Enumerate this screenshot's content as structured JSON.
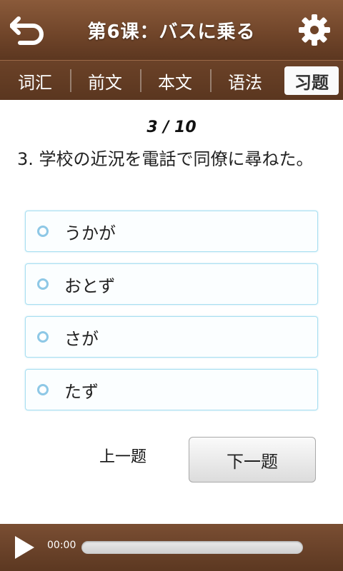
{
  "header": {
    "title": "第6课：バスに乗る",
    "back_icon": "back-arrow-icon",
    "settings_icon": "gear-icon"
  },
  "tabs": [
    {
      "label": "词汇",
      "active": false
    },
    {
      "label": "前文",
      "active": false
    },
    {
      "label": "本文",
      "active": false
    },
    {
      "label": "语法",
      "active": false
    },
    {
      "label": "习题",
      "active": true
    }
  ],
  "quiz": {
    "progress": "3 / 10",
    "question": "3. 学校の近況を電話で同僚に尋ねた。",
    "options": [
      "うかが",
      "おとず",
      "さが",
      "たず"
    ],
    "prev_label": "上一题",
    "next_label": "下一题"
  },
  "player": {
    "time": "00:00",
    "progress": 0
  },
  "colors": {
    "header_brown": "#6f4429",
    "option_border": "#a9dff1",
    "radio_blue": "#8ec8e6"
  }
}
